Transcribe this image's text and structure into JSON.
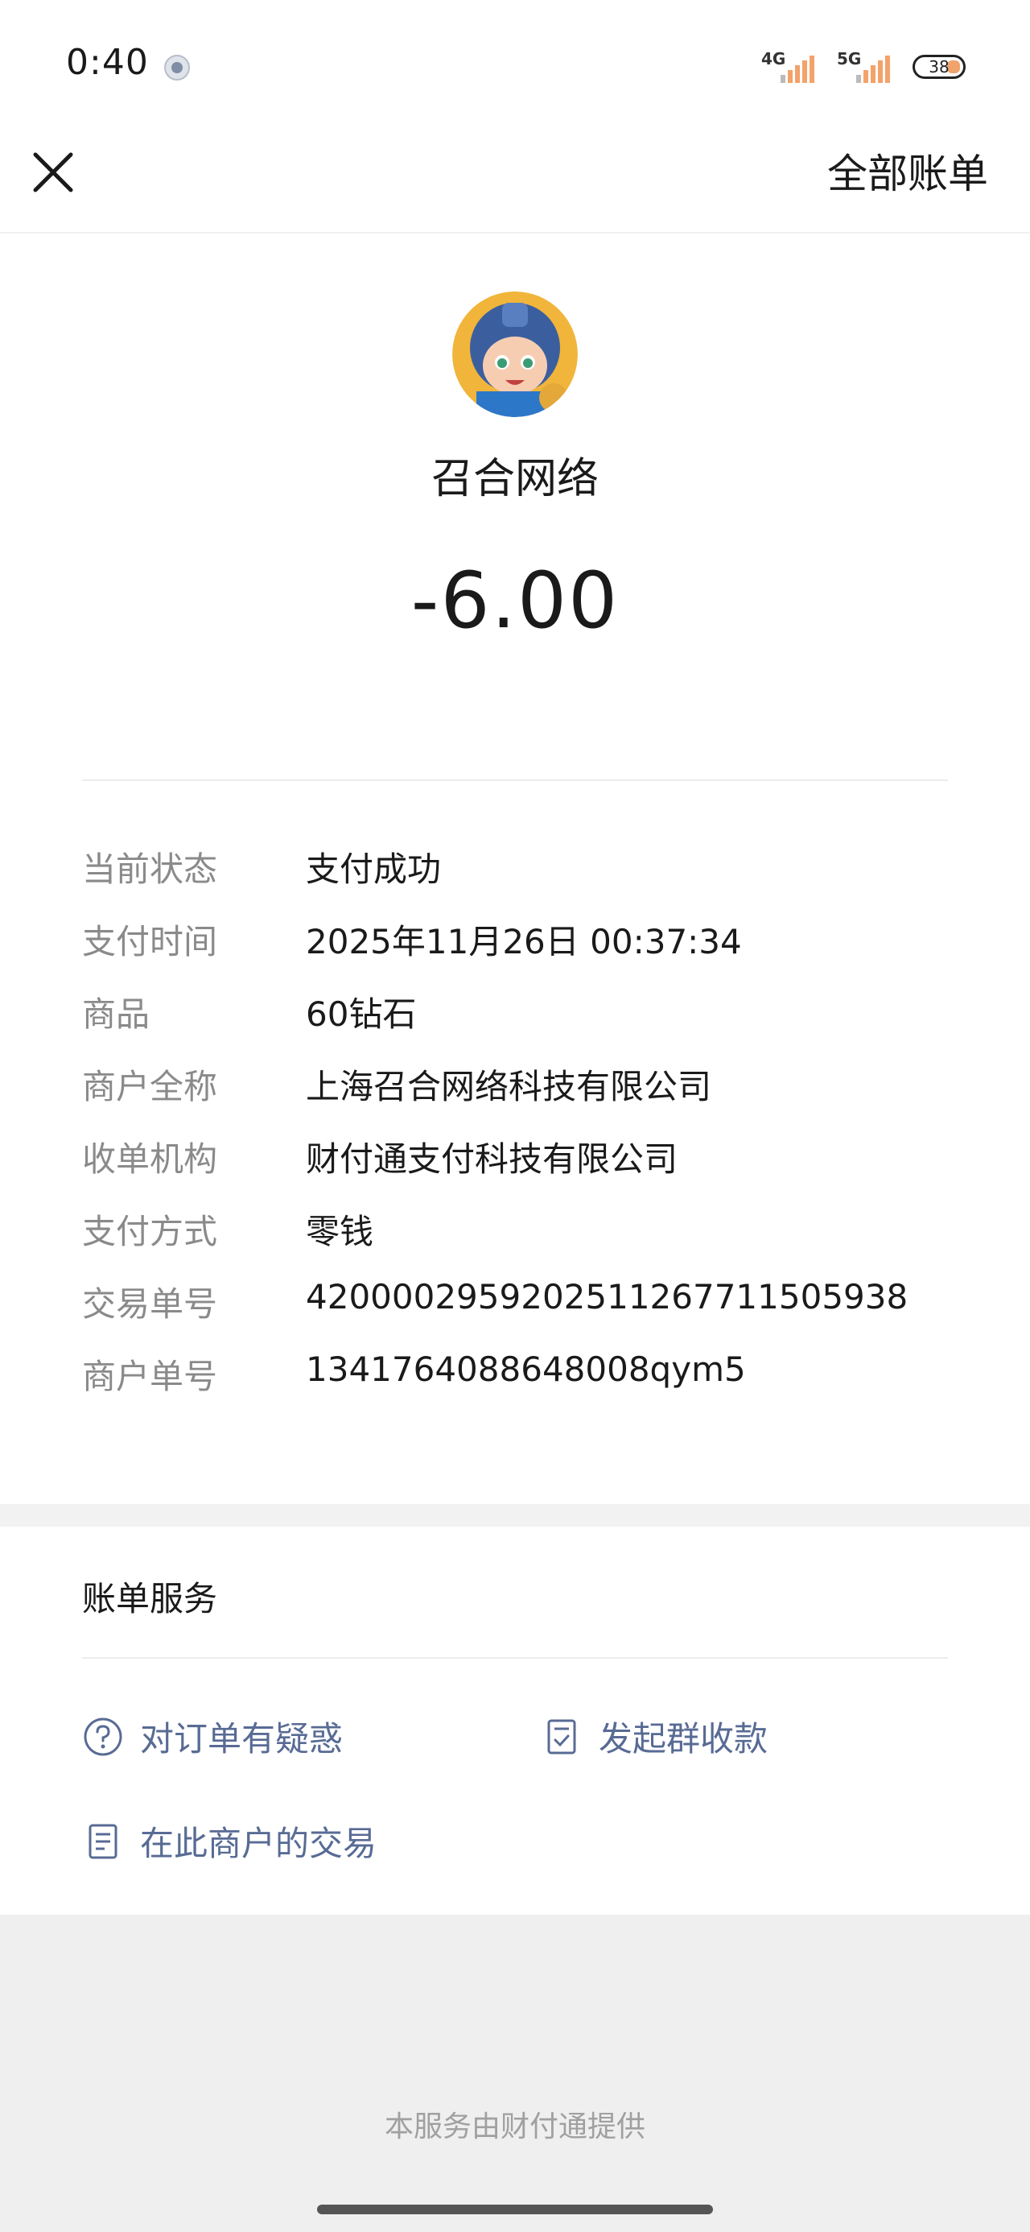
{
  "status_bar": {
    "time": "0:40",
    "network_1": "4G",
    "network_2": "5G",
    "battery": "38"
  },
  "nav": {
    "all_bills": "全部账单"
  },
  "header": {
    "merchant_name": "召合网络",
    "amount": "-6.00"
  },
  "details": [
    {
      "label": "当前状态",
      "value": "支付成功"
    },
    {
      "label": "支付时间",
      "value": "2025年11月26日 00:37:34"
    },
    {
      "label": "商品",
      "value": "60钻石"
    },
    {
      "label": "商户全称",
      "value": "上海召合网络科技有限公司"
    },
    {
      "label": "收单机构",
      "value": "财付通支付科技有限公司"
    },
    {
      "label": "支付方式",
      "value": "零钱"
    },
    {
      "label": "交易单号",
      "value": "4200002959202511267711505938"
    },
    {
      "label": "商户单号",
      "value": "1341764088648008qym5"
    }
  ],
  "services": {
    "title": "账单服务",
    "order_question": "对订单有疑惑",
    "group_collect": "发起群收款",
    "merchant_transactions": "在此商户的交易"
  },
  "footer": {
    "note": "本服务由财付通提供"
  },
  "colors": {
    "link": "#586b94",
    "label": "#8a8a8a",
    "text": "#1a1a1a"
  }
}
